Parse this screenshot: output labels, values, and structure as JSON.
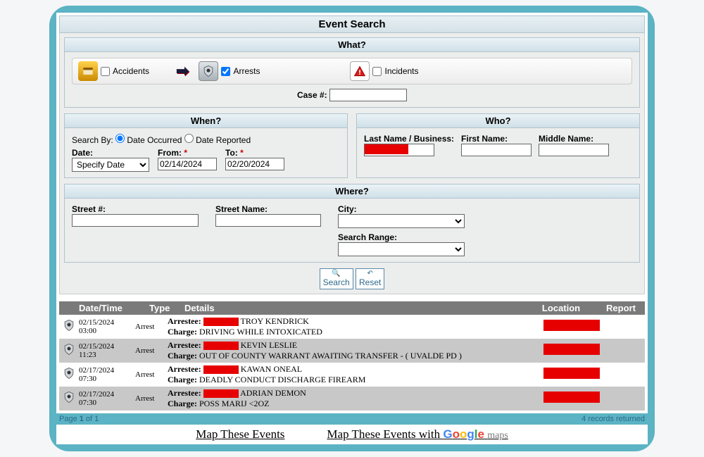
{
  "title": "Event Search",
  "what": {
    "header": "What?",
    "accidents_label": "Accidents",
    "accidents_checked": false,
    "arrests_label": "Arrests",
    "arrests_checked": true,
    "incidents_label": "Incidents",
    "incidents_checked": false,
    "case_label": "Case #:",
    "case_value": ""
  },
  "when": {
    "header": "When?",
    "search_by_label": "Search By:",
    "occurred_label": "Date Occurred",
    "reported_label": "Date Reported",
    "date_label": "Date:",
    "date_select": "Specify Date",
    "from_label": "From:",
    "from_value": "02/14/2024",
    "to_label": "To:",
    "to_value": "02/20/2024"
  },
  "who": {
    "header": "Who?",
    "lastname_label": "Last Name / Business:",
    "firstname_label": "First Name:",
    "middlename_label": "Middle Name:"
  },
  "where": {
    "header": "Where?",
    "streetnum_label": "Street #:",
    "streetname_label": "Street Name:",
    "city_label": "City:",
    "range_label": "Search Range:"
  },
  "buttons": {
    "search": "Search",
    "reset": "Reset"
  },
  "results": {
    "headers": {
      "datetime": "Date/Time",
      "type": "Type",
      "details": "Details",
      "location": "Location",
      "report": "Report"
    },
    "arrestee_label": "Arrestee:",
    "charge_label": "Charge:",
    "type_value": "Arrest",
    "rows": [
      {
        "date": "02/15/2024",
        "time": "03:00",
        "name": "TROY KENDRICK",
        "charge": "DRIVING WHILE INTOXICATED"
      },
      {
        "date": "02/15/2024",
        "time": "11:23",
        "name": "KEVIN LESLIE",
        "charge": "OUT OF COUNTY WARRANT AWAITING TRANSFER - ( UVALDE PD )"
      },
      {
        "date": "02/17/2024",
        "time": "07:30",
        "name": "KAWAN ONEAL",
        "charge": "DEADLY CONDUCT DISCHARGE FIREARM"
      },
      {
        "date": "02/17/2024",
        "time": "07:30",
        "name": "ADRIAN DEMON",
        "charge": "POSS MARIJ <2OZ"
      }
    ]
  },
  "pager": {
    "page_prefix": "Page ",
    "page_num": "1",
    "page_suffix": " of 1",
    "records": "4 records returned"
  },
  "mapbar": {
    "link1": "Map These Events",
    "link2_prefix": "Map These Events with "
  }
}
